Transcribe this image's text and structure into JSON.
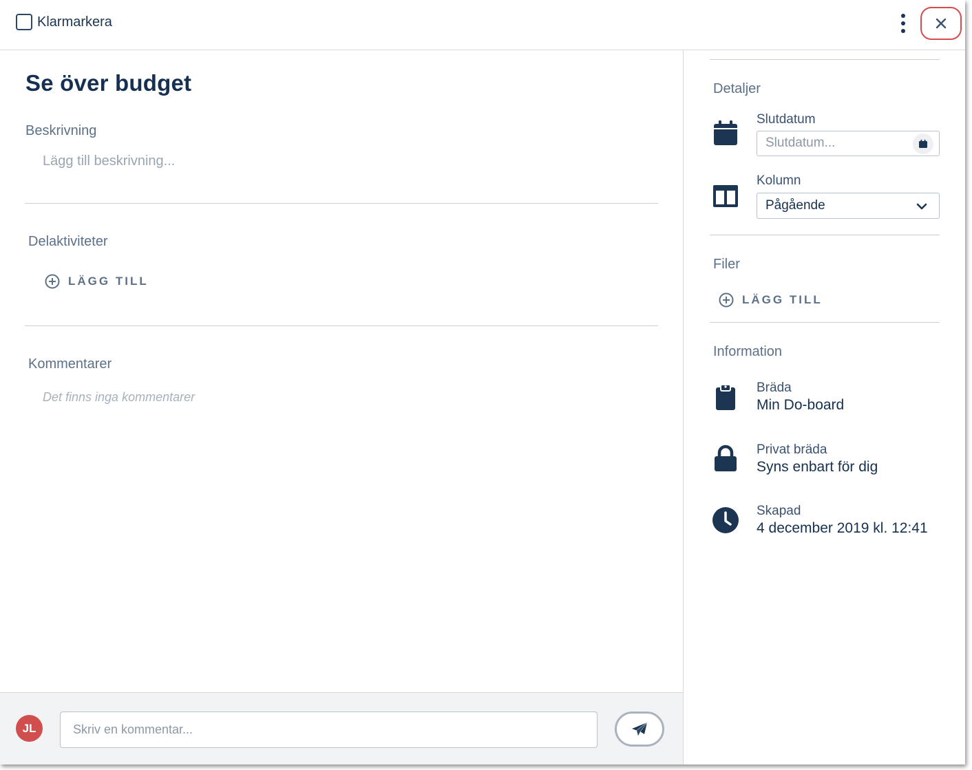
{
  "header": {
    "mark_done_label": "Klarmarkera",
    "more_icon": "more-vertical-icon",
    "close_icon": "close-icon",
    "close_highlight_color": "#d94a4a"
  },
  "task": {
    "title": "Se över budget",
    "description_label": "Beskrivning",
    "description_placeholder": "Lägg till beskrivning...",
    "subtasks_label": "Delaktiviteter",
    "subtasks_add_label": "LÄGG TILL",
    "comments_label": "Kommentarer",
    "no_comments_text": "Det finns inga kommentarer"
  },
  "comment_bar": {
    "avatar_initials": "JL",
    "avatar_color": "#d04e4e",
    "input_placeholder": "Skriv en kommentar...",
    "send_icon": "send-icon"
  },
  "details": {
    "heading": "Detaljer",
    "due_date_label": "Slutdatum",
    "due_date_placeholder": "Slutdatum...",
    "column_label": "Kolumn",
    "column_value": "Pågående"
  },
  "files": {
    "heading": "Filer",
    "add_label": "LÄGG TILL"
  },
  "information": {
    "heading": "Information",
    "board_label": "Bräda",
    "board_value": "Min Do-board",
    "privacy_label": "Privat bräda",
    "privacy_value": "Syns enbart för dig",
    "created_label": "Skapad",
    "created_value": "4 december 2019 kl. 12:41"
  },
  "colors": {
    "primary": "#1b3553",
    "muted": "#5c7088"
  }
}
